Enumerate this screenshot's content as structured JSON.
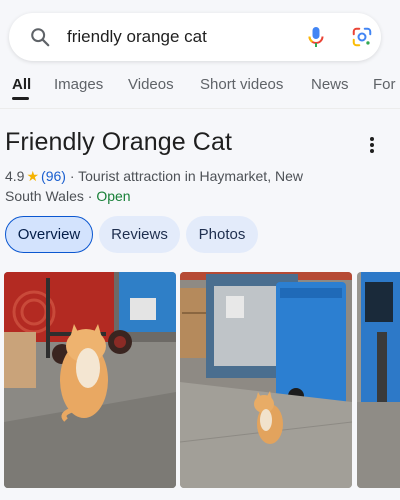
{
  "search": {
    "query": "friendly orange cat"
  },
  "tabs": [
    {
      "label": "All",
      "active": true
    },
    {
      "label": "Images"
    },
    {
      "label": "Videos"
    },
    {
      "label": "Short videos"
    },
    {
      "label": "News"
    },
    {
      "label": "For"
    }
  ],
  "place": {
    "title": "Friendly Orange Cat",
    "rating": "4.9",
    "review_count": "(96)",
    "category_location": "· Tourist attraction in Haymarket, New",
    "location_cont": "South Wales",
    "separator": "·",
    "status": "Open"
  },
  "chips": [
    {
      "label": "Overview",
      "active": true
    },
    {
      "label": "Reviews"
    },
    {
      "label": "Photos"
    }
  ],
  "colors": {
    "accent": "#0b57d0",
    "chip_active_bg": "#d3e3fd",
    "open_green": "#188038",
    "link_blue": "#1a5fcf",
    "star": "#f5b301"
  },
  "icons": [
    "search-icon",
    "mic-icon",
    "lens-icon",
    "more-vert-icon",
    "star-icon"
  ]
}
